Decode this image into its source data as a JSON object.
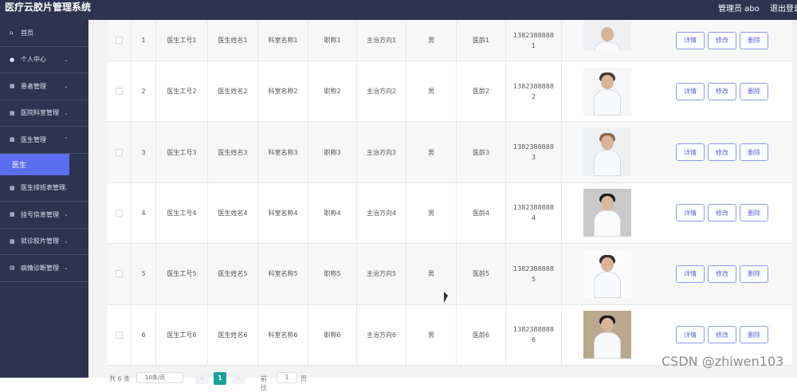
{
  "header": {
    "title": "医疗云胶片管理系统",
    "admin": "管理员 abo",
    "logout": "退出登录"
  },
  "sidebar": {
    "items": [
      {
        "label": "首页",
        "icon": "home-icon",
        "has_chevron": false
      },
      {
        "label": "个人中心",
        "icon": "user-icon",
        "has_chevron": true
      },
      {
        "label": "患者管理",
        "icon": "grid-icon",
        "has_chevron": true
      },
      {
        "label": "医院科室管理",
        "icon": "grid-icon",
        "has_chevron": true
      },
      {
        "label": "医生管理",
        "icon": "grid-icon",
        "has_chevron": true
      },
      {
        "label": "医生",
        "icon": "",
        "active": true
      },
      {
        "label": "医生排班表管理",
        "icon": "grid-icon",
        "has_chevron": true
      },
      {
        "label": "挂号信息管理",
        "icon": "grid-icon",
        "has_chevron": true
      },
      {
        "label": "就诊胶片管理",
        "icon": "grid-icon",
        "has_chevron": true
      },
      {
        "label": "病情诊断管理",
        "icon": "doc-icon",
        "has_chevron": true
      }
    ]
  },
  "table": {
    "rows": [
      {
        "index": "1",
        "gonghao": "医生工号1",
        "name": "医生姓名1",
        "dept": "科室名称1",
        "title": "职称1",
        "direction": "主治方向1",
        "gender": "男",
        "age": "医龄1",
        "phone_a": "1382388888",
        "phone_b": "1"
      },
      {
        "index": "2",
        "gonghao": "医生工号2",
        "name": "医生姓名2",
        "dept": "科室名称2",
        "title": "职称2",
        "direction": "主治方向2",
        "gender": "男",
        "age": "医龄2",
        "phone_a": "1382388888",
        "phone_b": "2"
      },
      {
        "index": "3",
        "gonghao": "医生工号3",
        "name": "医生姓名3",
        "dept": "科室名称3",
        "title": "职称3",
        "direction": "主治方向3",
        "gender": "男",
        "age": "医龄3",
        "phone_a": "1382388888",
        "phone_b": "3"
      },
      {
        "index": "4",
        "gonghao": "医生工号4",
        "name": "医生姓名4",
        "dept": "科室名称4",
        "title": "职称4",
        "direction": "主治方向4",
        "gender": "男",
        "age": "医龄4",
        "phone_a": "1382388888",
        "phone_b": "4"
      },
      {
        "index": "5",
        "gonghao": "医生工号5",
        "name": "医生姓名5",
        "dept": "科室名称5",
        "title": "职称5",
        "direction": "主治方向5",
        "gender": "男",
        "age": "医龄5",
        "phone_a": "1382388888",
        "phone_b": "5"
      },
      {
        "index": "6",
        "gonghao": "医生工号6",
        "name": "医生姓名6",
        "dept": "科室名称6",
        "title": "职称6",
        "direction": "主治方向6",
        "gender": "男",
        "age": "医龄6",
        "phone_a": "1382388888",
        "phone_b": "6"
      }
    ],
    "actions": {
      "detail": "详情",
      "edit": "修改",
      "delete": "删除"
    }
  },
  "pagination": {
    "total": "共 6 条",
    "page_size": "10条/页",
    "current_page": "1",
    "goto_label": "前往",
    "goto_value": "1",
    "goto_unit": "页"
  },
  "watermark": "CSDN @zhiwen103"
}
